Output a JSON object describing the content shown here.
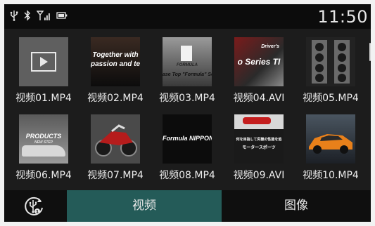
{
  "status": {
    "time": "11:50",
    "icons": [
      "usb-icon",
      "bluetooth-icon",
      "signal-icon",
      "battery-icon"
    ]
  },
  "files": [
    {
      "name": "视频01.MP4",
      "thumb_icon": "play-icon"
    },
    {
      "name": "视频02.MP4",
      "thumb_text": [
        "Together with",
        "passion and tec"
      ]
    },
    {
      "name": "视频03.MP4",
      "thumb_text": [
        "FORMULA",
        "ase Top \"Formula\" Serie"
      ]
    },
    {
      "name": "视频04.AVI",
      "thumb_text": [
        "Driver's",
        "o Series TI"
      ]
    },
    {
      "name": "视频05.MP4"
    },
    {
      "name": "视频06.MP4",
      "thumb_text": [
        "PRODUCTS",
        "NEW STEP"
      ]
    },
    {
      "name": "视频07.MP4"
    },
    {
      "name": "视频08.MP4",
      "thumb_text": [
        "Formula NIPPON"
      ]
    },
    {
      "name": "视频09.AVI",
      "thumb_text": [
        "何を目指して究極の性能を追",
        "モータースポーツ"
      ]
    },
    {
      "name": "视频10.MP4"
    }
  ],
  "bottom": {
    "source_icon": "usb-source-icon",
    "tabs": [
      {
        "label": "视频",
        "active": true
      },
      {
        "label": "图像",
        "active": false
      }
    ]
  },
  "colors": {
    "accent_tab": "#245b58",
    "background": "#1c1c1c"
  }
}
